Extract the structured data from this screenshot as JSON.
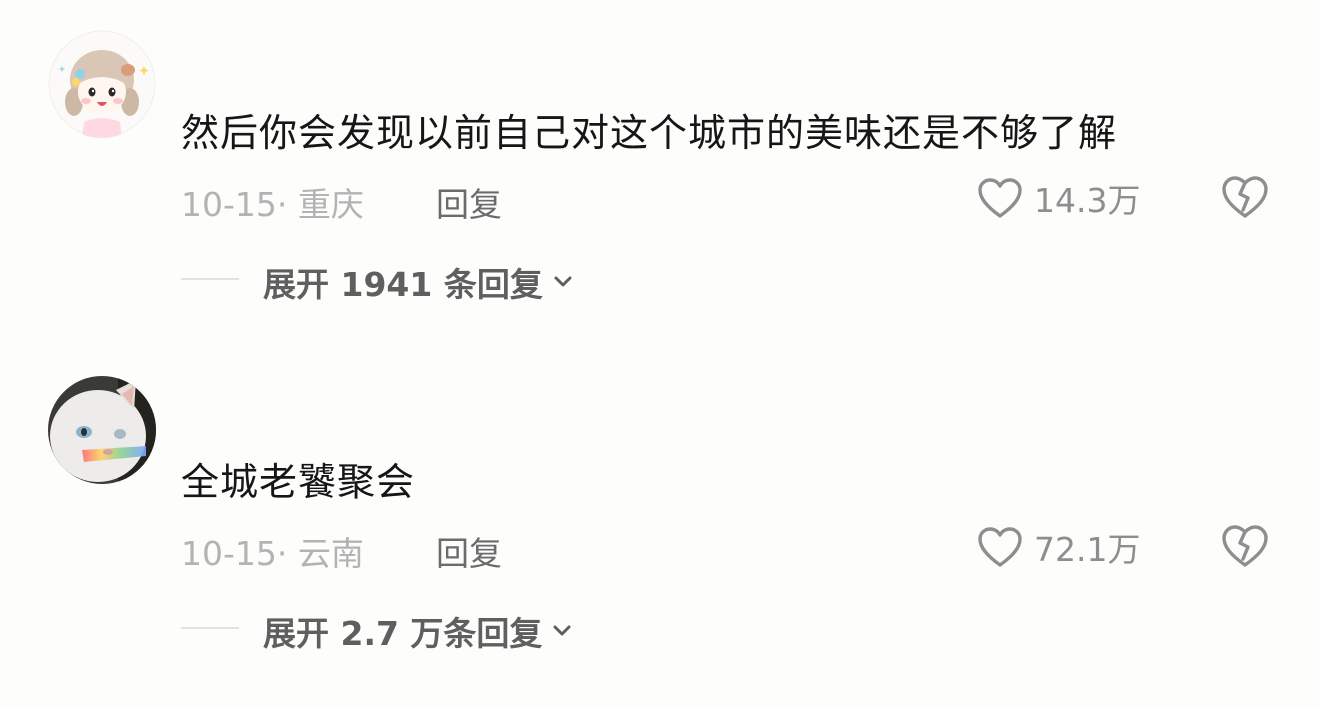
{
  "comments": [
    {
      "text": "然后你会发现以前自己对这个城市的美味还是不够了解",
      "meta": "10-15· 重庆",
      "reply_label": "回复",
      "like_count": "14.3万",
      "expand_label": "展开 1941 条回复",
      "avatar_icon": "cartoon-girl-avatar"
    },
    {
      "text": "全城老饕聚会",
      "meta": "10-15· 云南",
      "reply_label": "回复",
      "like_count": "72.1万",
      "expand_label": "展开 2.7 万条回复",
      "avatar_icon": "cat-avatar"
    }
  ],
  "icons": {
    "like": "heart-outline-icon",
    "dislike": "broken-heart-icon",
    "expand": "chevron-down-icon"
  },
  "colors": {
    "background": "#fdfdfb",
    "text": "#161616",
    "meta": "#b3b3b3",
    "reply": "#6b6b6b",
    "expand": "#5f5f5f",
    "icon": "#8e8e8e"
  }
}
